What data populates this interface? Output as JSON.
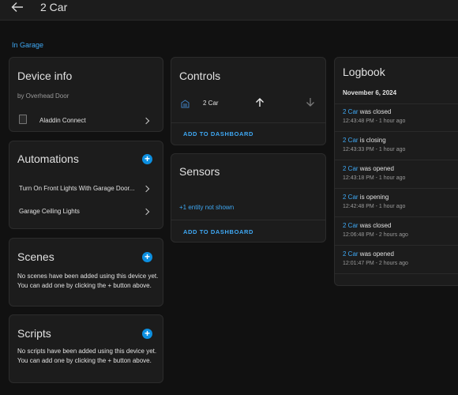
{
  "header": {
    "title": "2 Car"
  },
  "area": {
    "label": "In Garage"
  },
  "device_info": {
    "title": "Device info",
    "manufacturer": "by Overhead Door",
    "integration": "Aladdin Connect"
  },
  "automations": {
    "title": "Automations",
    "items": [
      "Turn On Front Lights With Garage Door...",
      "Garage Ceiling Lights"
    ]
  },
  "scenes": {
    "title": "Scenes",
    "empty_text": "No scenes have been added using this device yet. You can add one by clicking the + button above."
  },
  "scripts": {
    "title": "Scripts",
    "empty_text": "No scripts have been added using this device yet. You can add one by clicking the + button above."
  },
  "controls": {
    "title": "Controls",
    "entity": "2 Car",
    "action": "ADD TO DASHBOARD"
  },
  "sensors": {
    "title": "Sensors",
    "hidden_entities": "+1 entity not shown",
    "action": "ADD TO DASHBOARD"
  },
  "logbook": {
    "title": "Logbook",
    "date": "November 6, 2024",
    "entries": [
      {
        "entity": "2 Car",
        "message": "was closed",
        "time": "12:43:48 PM - 1 hour ago"
      },
      {
        "entity": "2 Car",
        "message": "is closing",
        "time": "12:43:33 PM - 1 hour ago"
      },
      {
        "entity": "2 Car",
        "message": "was opened",
        "time": "12:43:18 PM - 1 hour ago"
      },
      {
        "entity": "2 Car",
        "message": "is opening",
        "time": "12:42:48 PM - 1 hour ago"
      },
      {
        "entity": "2 Car",
        "message": "was closed",
        "time": "12:06:48 PM - 2 hours ago"
      },
      {
        "entity": "2 Car",
        "message": "was opened",
        "time": "12:01:47 PM - 2 hours ago"
      }
    ]
  },
  "colors": {
    "accent": "#3fa9f5",
    "card": "#1c1c1c",
    "background": "#111111"
  }
}
